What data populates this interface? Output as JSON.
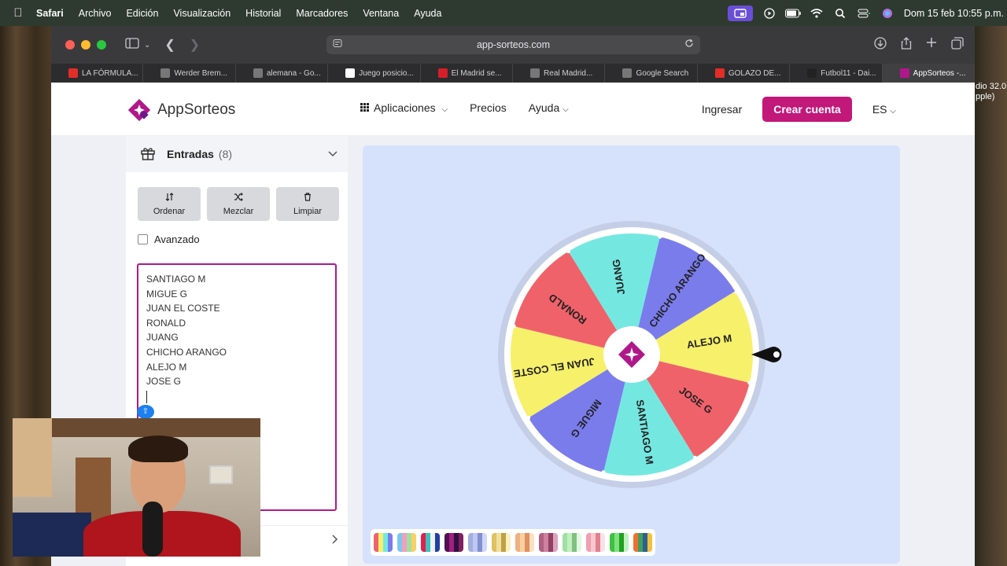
{
  "menubar": {
    "app": "Safari",
    "items": [
      "Archivo",
      "Edición",
      "Visualización",
      "Historial",
      "Marcadores",
      "Ventana",
      "Ayuda"
    ],
    "clock": "Dom 15 feb 10:55 p.m."
  },
  "desktop": {
    "peek_line1": "dio 32.0",
    "peek_line2": "pple)"
  },
  "browser": {
    "url": "app-sorteos.com",
    "tabs": [
      {
        "label": "LA FÓRMULA...",
        "color": "#e52d27",
        "icon": "youtube-icon"
      },
      {
        "label": "Werder Brem...",
        "color": "#777777",
        "icon": "tab-icon"
      },
      {
        "label": "alemana - Go...",
        "color": "#777777",
        "icon": "google-icon"
      },
      {
        "label": "Juego posicio...",
        "color": "#ffffff",
        "icon": "tab-icon"
      },
      {
        "label": "El Madrid se...",
        "color": "#d41f2b",
        "icon": "marca-icon"
      },
      {
        "label": "Real Madrid...",
        "color": "#777777",
        "icon": "tab-icon"
      },
      {
        "label": "Google Search",
        "color": "#777777",
        "icon": "google-icon"
      },
      {
        "label": "GOLAZO DE...",
        "color": "#e52d27",
        "icon": "youtube-icon"
      },
      {
        "label": "Futbol11 - Dai...",
        "color": "#222222",
        "icon": "tab-icon"
      },
      {
        "label": "AppSorteos -...",
        "color": "#b0188a",
        "icon": "appsorteos-icon"
      }
    ]
  },
  "nav": {
    "logo_app": "App",
    "logo_sorteos": "Sorteos",
    "aplicaciones": "Aplicaciones",
    "precios": "Precios",
    "ayuda": "Ayuda",
    "ingresar": "Ingresar",
    "crear_cuenta": "Crear cuenta",
    "lang": "ES"
  },
  "panel": {
    "title": "Entradas",
    "count": "(8)",
    "ordenar": "Ordenar",
    "mezclar": "Mezclar",
    "limpiar": "Limpiar",
    "avanzado": "Avanzado",
    "entries": [
      "SANTIAGO M",
      "MIGUE G",
      "JUAN EL COSTE",
      "RONALD",
      "JUANG",
      "CHICHO ARANGO",
      "ALEJO M",
      "JOSE G"
    ]
  },
  "wheel": {
    "segments": [
      {
        "label": "ALEJO M",
        "color": "#f7f06a"
      },
      {
        "label": "JOSE G",
        "color": "#f0626a"
      },
      {
        "label": "SANTIAGO M",
        "color": "#74e8e0"
      },
      {
        "label": "MIGUE G",
        "color": "#7a7cec"
      },
      {
        "label": "JUAN EL COSTE",
        "color": "#f7f06a"
      },
      {
        "label": "RONALD",
        "color": "#f0626a"
      },
      {
        "label": "JUANG",
        "color": "#74e8e0"
      },
      {
        "label": "CHICHO ARANGO",
        "color": "#7a7cec"
      }
    ],
    "hub_color": "#b0188a"
  },
  "palettes": [
    [
      "#f0626a",
      "#f7f06a",
      "#74e8e0",
      "#7a7cec"
    ],
    [
      "#7ac8f0",
      "#f0a0c0",
      "#a0e0a0",
      "#f7d06a"
    ],
    [
      "#e0204a",
      "#40c0c0",
      "#f0f0f0",
      "#2040a0"
    ],
    [
      "#501050",
      "#a02080",
      "#301040",
      "#802060"
    ],
    [
      "#a0b0e0",
      "#c0c8f0",
      "#8090d0",
      "#d0d8f8"
    ],
    [
      "#e0c060",
      "#f0e0a0",
      "#c0a040",
      "#f8f0c0"
    ],
    [
      "#f0b080",
      "#f8d0a0",
      "#e09060",
      "#fce0c0"
    ],
    [
      "#b06080",
      "#d080a0",
      "#904060",
      "#e0a0c0"
    ],
    [
      "#a0e0a0",
      "#c0f0c0",
      "#80c080",
      "#e0f8e0"
    ],
    [
      "#f0a0b0",
      "#f8c8d0",
      "#e08090",
      "#fce0e8"
    ],
    [
      "#40c040",
      "#80e080",
      "#20a020",
      "#c0f0c0"
    ],
    [
      "#f07030",
      "#40a060",
      "#306090",
      "#f0c040"
    ]
  ]
}
